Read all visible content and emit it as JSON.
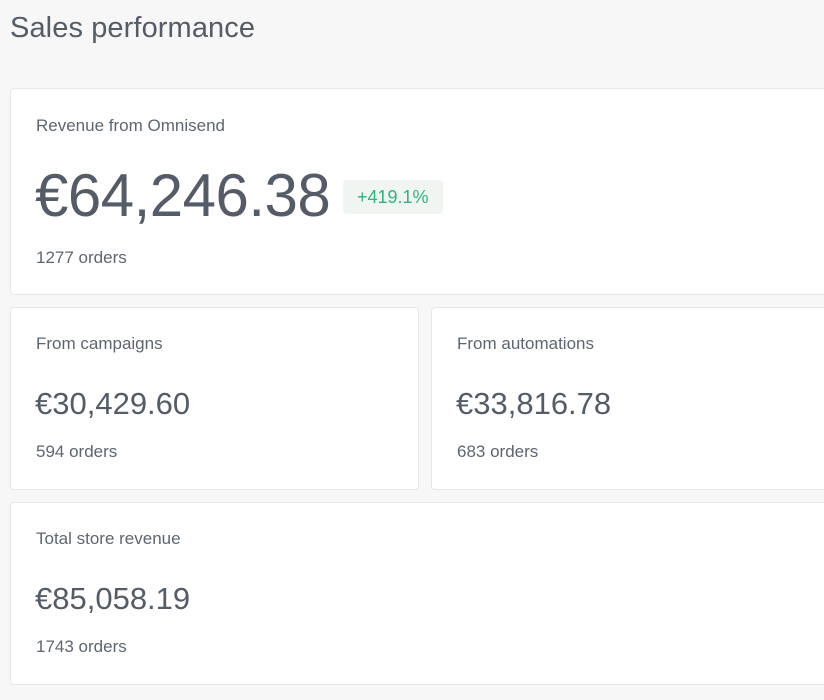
{
  "page": {
    "title": "Sales performance"
  },
  "omnisend": {
    "label": "Revenue from Omnisend",
    "value": "€64,246.38",
    "change": "+419.1%",
    "orders": "1277 orders"
  },
  "campaigns": {
    "label": "From campaigns",
    "value": "€30,429.60",
    "orders": "594 orders"
  },
  "automations": {
    "label": "From automations",
    "value": "€33,816.78",
    "orders": "683 orders"
  },
  "total": {
    "label": "Total store revenue",
    "value": "€85,058.19",
    "orders": "1743 orders"
  },
  "colors": {
    "positive_change": "#2db57d",
    "text_primary": "#535c67",
    "card_border": "#e5e7ea"
  }
}
